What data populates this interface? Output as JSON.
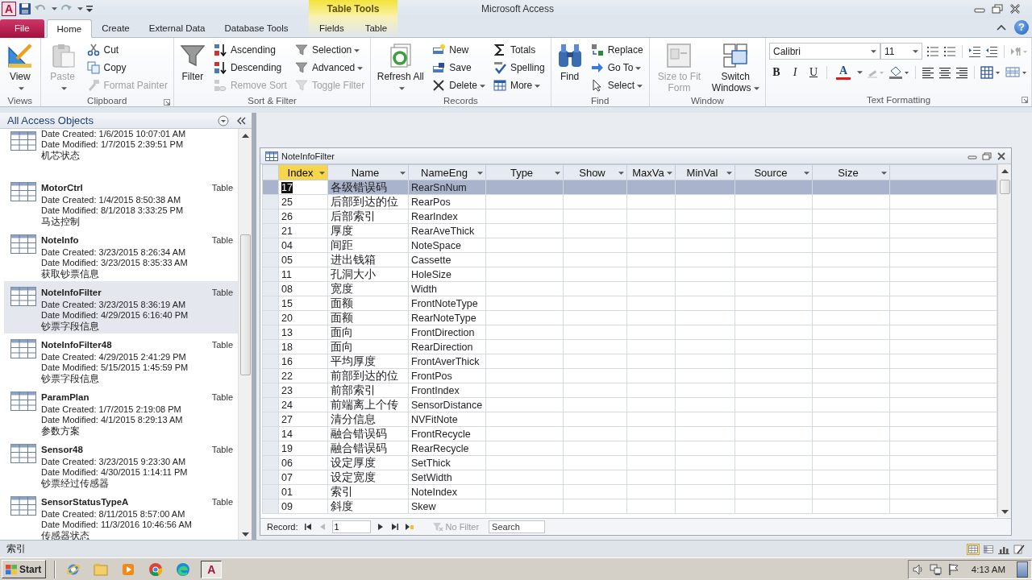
{
  "window": {
    "app_logo": "A",
    "context_group": "Table Tools",
    "title": "Microsoft Access",
    "help": "?"
  },
  "ribbon_tabs": [
    {
      "label": "File",
      "kind": "file",
      "selected": false
    },
    {
      "label": "Home",
      "kind": "normal",
      "selected": true
    },
    {
      "label": "Create",
      "kind": "normal",
      "selected": false
    },
    {
      "label": "External Data",
      "kind": "normal",
      "selected": false
    },
    {
      "label": "Database Tools",
      "kind": "normal",
      "selected": false
    },
    {
      "label": "Fields",
      "kind": "context",
      "selected": false
    },
    {
      "label": "Table",
      "kind": "context",
      "selected": false
    }
  ],
  "ribbon_groups": [
    {
      "label": "Views",
      "launcher": false,
      "commands": [
        {
          "label": "View",
          "kind": "large",
          "dropdown": true,
          "disabled": false
        }
      ]
    },
    {
      "label": "Clipboard",
      "launcher": true,
      "commands": [
        {
          "label": "Paste",
          "kind": "large",
          "dropdown": true,
          "disabled": true
        },
        {
          "label": "Cut",
          "kind": "small",
          "dropdown": false,
          "disabled": false
        },
        {
          "label": "Copy",
          "kind": "small",
          "dropdown": false,
          "disabled": false
        },
        {
          "label": "Format Painter",
          "kind": "small",
          "dropdown": false,
          "disabled": true
        }
      ]
    },
    {
      "label": "Sort & Filter",
      "launcher": false,
      "commands": [
        {
          "label": "Filter",
          "kind": "large",
          "dropdown": false,
          "disabled": false
        },
        {
          "label": "Ascending",
          "kind": "small",
          "dropdown": false,
          "disabled": false
        },
        {
          "label": "Descending",
          "kind": "small",
          "dropdown": false,
          "disabled": false
        },
        {
          "label": "Remove Sort",
          "kind": "small",
          "dropdown": false,
          "disabled": true
        },
        {
          "label": "Selection",
          "kind": "small",
          "dropdown": true,
          "disabled": false
        },
        {
          "label": "Advanced",
          "kind": "small",
          "dropdown": true,
          "disabled": false
        },
        {
          "label": "Toggle Filter",
          "kind": "small",
          "dropdown": false,
          "disabled": true
        }
      ]
    },
    {
      "label": "Records",
      "launcher": false,
      "commands": [
        {
          "label": "Refresh All",
          "kind": "large",
          "dropdown": true,
          "disabled": false
        },
        {
          "label": "New",
          "kind": "small",
          "dropdown": false,
          "disabled": false
        },
        {
          "label": "Save",
          "kind": "small",
          "dropdown": false,
          "disabled": false
        },
        {
          "label": "Delete",
          "kind": "small",
          "dropdown": true,
          "disabled": false
        },
        {
          "label": "Totals",
          "kind": "small",
          "dropdown": false,
          "disabled": false
        },
        {
          "label": "Spelling",
          "kind": "small",
          "dropdown": false,
          "disabled": false
        },
        {
          "label": "More",
          "kind": "small",
          "dropdown": true,
          "disabled": false
        }
      ]
    },
    {
      "label": "Find",
      "launcher": false,
      "commands": [
        {
          "label": "Find",
          "kind": "large",
          "dropdown": false,
          "disabled": false
        },
        {
          "label": "Replace",
          "kind": "small",
          "dropdown": false,
          "disabled": false
        },
        {
          "label": "Go To",
          "kind": "small",
          "dropdown": true,
          "disabled": false
        },
        {
          "label": "Select",
          "kind": "small",
          "dropdown": true,
          "disabled": false
        }
      ]
    },
    {
      "label": "Window",
      "launcher": false,
      "commands": [
        {
          "label": "Size to Fit Form",
          "kind": "large",
          "dropdown": false,
          "disabled": true
        },
        {
          "label": "Switch Windows",
          "kind": "large",
          "dropdown": true,
          "disabled": false
        }
      ]
    }
  ],
  "text_formatting": {
    "label": "Text Formatting",
    "launcher": true,
    "font": "Calibri",
    "font_size": "11",
    "bold": "B",
    "italic": "I",
    "underline": "U",
    "font_color": "A"
  },
  "nav": {
    "title": "All Access Objects",
    "items": [
      {
        "created": "Date Created: 1/6/2015 10:07:01 AM",
        "modified": "Date Modified: 1/7/2015 2:39:51 PM",
        "description": "机芯状态",
        "selected": false
      },
      {
        "name": "MotorCtrl",
        "type": "Table",
        "created": "Date Created: 1/4/2015 8:50:38 AM",
        "modified": "Date Modified: 8/1/2018 3:33:25 PM",
        "description": "马达控制",
        "selected": false
      },
      {
        "name": "NoteInfo",
        "type": "Table",
        "created": "Date Created: 3/23/2015 8:26:34 AM",
        "modified": "Date Modified: 3/23/2015 8:35:33 AM",
        "description": "获取钞票信息",
        "selected": false
      },
      {
        "name": "NoteInfoFilter",
        "type": "Table",
        "created": "Date Created: 3/23/2015 8:36:19 AM",
        "modified": "Date Modified: 4/29/2015 6:16:40 PM",
        "description": "钞票字段信息",
        "selected": true
      },
      {
        "name": "NoteInfoFilter48",
        "type": "Table",
        "created": "Date Created: 4/29/2015 2:41:29 PM",
        "modified": "Date Modified: 5/15/2015 1:45:59 PM",
        "description": "钞票字段信息",
        "selected": false
      },
      {
        "name": "ParamPlan",
        "type": "Table",
        "created": "Date Created: 1/7/2015 2:19:08 PM",
        "modified": "Date Modified: 4/1/2015 8:29:13 AM",
        "description": "参数方案",
        "selected": false
      },
      {
        "name": "Sensor48",
        "type": "Table",
        "created": "Date Created: 3/23/2015 9:23:30 AM",
        "modified": "Date Modified: 4/30/2015 1:14:11 PM",
        "description": "钞票经过传感器",
        "selected": false
      },
      {
        "name": "SensorStatusTypeA",
        "type": "Table",
        "created": "Date Created: 8/11/2015 8:57:00 AM",
        "modified": "Date Modified: 11/3/2016 10:46:56 AM",
        "description": "传感器状态",
        "selected": false
      }
    ]
  },
  "datasheet": {
    "title": "NoteInfoFilter",
    "columns": [
      {
        "label": "Index",
        "selected": true
      },
      {
        "label": "Name",
        "selected": false
      },
      {
        "label": "NameEng",
        "selected": false
      },
      {
        "label": "Type",
        "selected": false
      },
      {
        "label": "Show",
        "selected": false
      },
      {
        "label": "MaxVa",
        "selected": false
      },
      {
        "label": "MinVal",
        "selected": false
      },
      {
        "label": "Source",
        "selected": false
      },
      {
        "label": "Size",
        "selected": false
      }
    ],
    "rows": [
      {
        "index": "17",
        "name": "各级错误码",
        "name_eng": "RearSnNum",
        "selected": true
      },
      {
        "index": "25",
        "name": "后部到达的位",
        "name_eng": "RearPos",
        "selected": false
      },
      {
        "index": "26",
        "name": "后部索引",
        "name_eng": "RearIndex",
        "selected": false
      },
      {
        "index": "21",
        "name": "厚度",
        "name_eng": "RearAveThick",
        "selected": false
      },
      {
        "index": "04",
        "name": "间距",
        "name_eng": "NoteSpace",
        "selected": false
      },
      {
        "index": "05",
        "name": "进出钱箱",
        "name_eng": "Cassette",
        "selected": false
      },
      {
        "index": "11",
        "name": "孔洞大小",
        "name_eng": "HoleSize",
        "selected": false
      },
      {
        "index": "08",
        "name": "宽度",
        "name_eng": "Width",
        "selected": false
      },
      {
        "index": "15",
        "name": "面额",
        "name_eng": "FrontNoteType",
        "selected": false
      },
      {
        "index": "20",
        "name": "面额",
        "name_eng": "RearNoteType",
        "selected": false
      },
      {
        "index": "13",
        "name": "面向",
        "name_eng": "FrontDirection",
        "selected": false
      },
      {
        "index": "18",
        "name": "面向",
        "name_eng": "RearDirection",
        "selected": false
      },
      {
        "index": "16",
        "name": "平均厚度",
        "name_eng": "FrontAverThick",
        "selected": false
      },
      {
        "index": "22",
        "name": "前部到达的位",
        "name_eng": "FrontPos",
        "selected": false
      },
      {
        "index": "23",
        "name": "前部索引",
        "name_eng": "FrontIndex",
        "selected": false
      },
      {
        "index": "24",
        "name": "前端离上个传",
        "name_eng": "SensorDistance",
        "selected": false
      },
      {
        "index": "27",
        "name": "清分信息",
        "name_eng": "NVFitNote",
        "selected": false
      },
      {
        "index": "14",
        "name": "融合错误码",
        "name_eng": "FrontRecycle",
        "selected": false
      },
      {
        "index": "19",
        "name": "融合错误码",
        "name_eng": "RearRecycle",
        "selected": false
      },
      {
        "index": "06",
        "name": "设定厚度",
        "name_eng": "SetThick",
        "selected": false
      },
      {
        "index": "07",
        "name": "设定宽度",
        "name_eng": "SetWidth",
        "selected": false
      },
      {
        "index": "01",
        "name": "索引",
        "name_eng": "NoteIndex",
        "selected": false
      },
      {
        "index": "09",
        "name": "斜度",
        "name_eng": "Skew",
        "selected": false
      }
    ],
    "record_nav": {
      "label": "Record:",
      "current": "1",
      "filter": "No Filter",
      "search_placeholder": "Search"
    }
  },
  "status_bar": {
    "text": "索引"
  },
  "taskbar": {
    "start": "Start",
    "apps": [
      {
        "kind": "ie",
        "selected": false
      },
      {
        "kind": "folder",
        "selected": false
      },
      {
        "kind": "media",
        "selected": false
      },
      {
        "kind": "chrome",
        "selected": false
      },
      {
        "kind": "edge",
        "selected": false
      },
      {
        "kind": "access",
        "label": "A",
        "selected": true
      }
    ],
    "time": "4:13 AM"
  }
}
